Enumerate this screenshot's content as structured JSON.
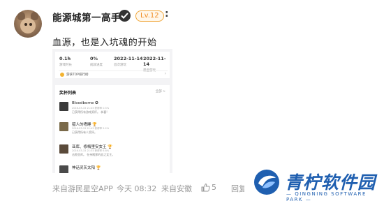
{
  "user": {
    "name": "能源城第一高手",
    "level": "Lv.12",
    "more": ":"
  },
  "post": {
    "text": "血源，也是入坑魂的开始"
  },
  "screenshot": {
    "stats": [
      {
        "value": "0.1h",
        "label": "游戏时长"
      },
      {
        "value": "0%",
        "label": "成就进度"
      },
      {
        "value": "2022-11-14",
        "label": "首次游玩"
      },
      {
        "value": "2022-11-14",
        "label": "最后游玩"
      }
    ],
    "rank_label": "游侠TOP排行榜",
    "achievements_title": "奖杯列表",
    "achievements_more": "全部 >",
    "achievements": [
      {
        "name": "Bloodborne ✪",
        "meta": "2016-03-15 21:45  获得率 0.5%",
        "desc": "已获得所有游戏奖杯。 恭喜!",
        "color": "#3a3a3a"
      },
      {
        "name": "猎人的嗜睡 🏆",
        "meta": "2016-03-15 21:45  获得率 5.2%",
        "desc": "已获得所有人奖杯。",
        "color": "#7a6a4a"
      },
      {
        "name": "亚库、修梅里安女王 🏆",
        "meta": "2016-03-15 21:35  获得率 6.8%",
        "desc": "击败亚库。 在亲睹那的血之女王。",
        "color": "#5a4a3a"
      },
      {
        "name": "神话灵灰太阳 🏆",
        "meta": "",
        "desc": "",
        "color": "#4a4a4a"
      }
    ]
  },
  "footer": {
    "source": "来自游民星空APP",
    "time": "今天 08:32",
    "location": "来自安徽",
    "likes": "5",
    "reply": "回复"
  },
  "watermark": {
    "cn": "青柠软件园",
    "en": "— QINGNING SOFTWARE PARK —"
  },
  "colors": {
    "level_border": "#f0a63a",
    "level_text": "#f08a1e",
    "watermark_blue": "#1f5fb0"
  }
}
